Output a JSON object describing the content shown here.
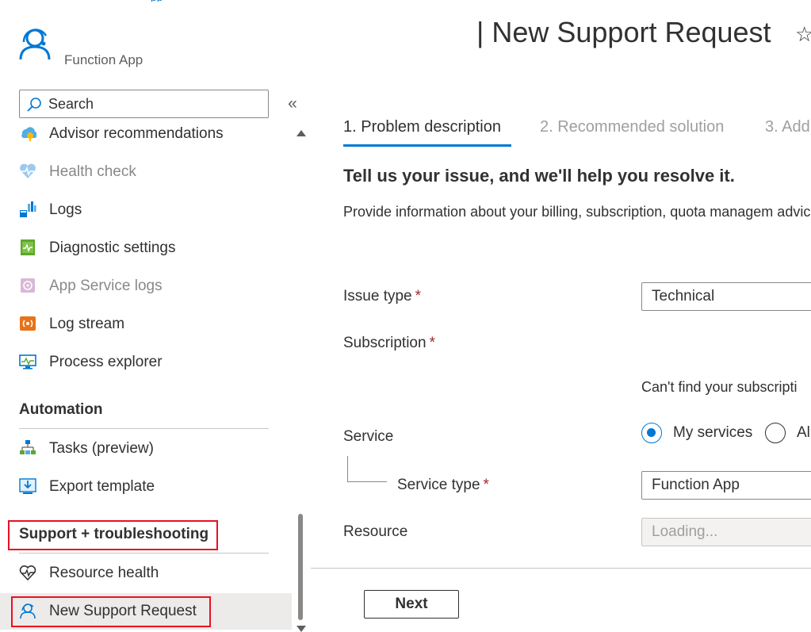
{
  "app": {
    "resource_type": "Function App",
    "top_link_fragment": "pp"
  },
  "search": {
    "placeholder": "Search",
    "value": ""
  },
  "sidebar": {
    "collapse_glyph": "«",
    "items_top": [
      {
        "label": "Advisor recommendations",
        "icon": "advisor-icon",
        "disabled": false
      },
      {
        "label": "Health check",
        "icon": "health-check-icon",
        "disabled": true
      },
      {
        "label": "Logs",
        "icon": "logs-icon",
        "disabled": false
      },
      {
        "label": "Diagnostic settings",
        "icon": "diagnostic-settings-icon",
        "disabled": false
      },
      {
        "label": "App Service logs",
        "icon": "app-service-logs-icon",
        "disabled": true
      },
      {
        "label": "Log stream",
        "icon": "log-stream-icon",
        "disabled": false
      },
      {
        "label": "Process explorer",
        "icon": "process-explorer-icon",
        "disabled": false
      }
    ],
    "automation": {
      "title": "Automation",
      "items": [
        {
          "label": "Tasks (preview)",
          "icon": "tasks-icon"
        },
        {
          "label": "Export template",
          "icon": "export-template-icon"
        }
      ]
    },
    "support": {
      "title": "Support + troubleshooting",
      "items": [
        {
          "label": "Resource health",
          "icon": "heart-icon"
        },
        {
          "label": "New Support Request",
          "icon": "support-person-icon",
          "selected": true
        }
      ]
    }
  },
  "main": {
    "title": "| New Support Request",
    "favorite_glyph": "☆",
    "steps": [
      "1. Problem description",
      "2. Recommended solution",
      "3. Add"
    ],
    "active_step": 0,
    "heading": "Tell us your issue, and we'll help you resolve it.",
    "description": "Provide information about your billing, subscription, quota managem advice).",
    "form": {
      "issue_type": {
        "label": "Issue type",
        "value": "Technical",
        "required": "*"
      },
      "subscription": {
        "label": "Subscription",
        "required": "*",
        "help": "Can't find your subscripti"
      },
      "service": {
        "label": "Service",
        "options": [
          "My services",
          "Al"
        ],
        "selected": "My services"
      },
      "service_type": {
        "label": "Service type",
        "value": "Function App",
        "required": "*"
      },
      "resource": {
        "label": "Resource",
        "placeholder": "Loading..."
      }
    },
    "next_label": "Next"
  },
  "colors": {
    "accent": "#0078d4",
    "highlight": "#e81123",
    "required": "#a4262c",
    "selected_bg": "#edebe9"
  }
}
